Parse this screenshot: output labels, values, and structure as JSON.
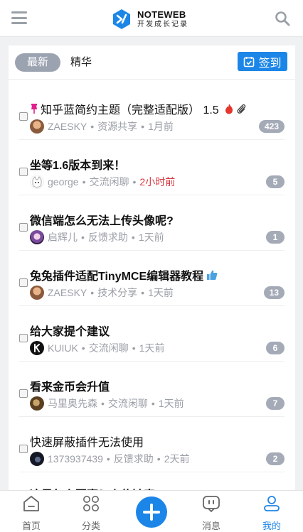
{
  "header": {
    "logo_title": "NOTEWEB",
    "logo_subtitle": "开发成长记录"
  },
  "tabs": {
    "latest": "最新",
    "featured": "精华",
    "signin": "签到"
  },
  "topics": [
    {
      "title": "知乎蓝简约主题（完整适配版） 1.5",
      "author": "ZAESKY",
      "category": "资源共享",
      "time": "1月前",
      "replies": "423",
      "pinned": true
    },
    {
      "title": "坐等1.6版本到来！",
      "author": "george",
      "category": "交流闲聊",
      "time": "2小时前",
      "replies": "5"
    },
    {
      "title": "微信端怎么无法上传头像呢?",
      "author": "启辉儿",
      "category": "反馈求助",
      "time": "1天前",
      "replies": "1"
    },
    {
      "title": "兔兔插件适配TinyMCE编辑器教程",
      "author": "ZAESKY",
      "category": "技术分享",
      "time": "1天前",
      "replies": "13"
    },
    {
      "title": "给大家提个建议",
      "author": "KUIUK",
      "category": "交流闲聊",
      "time": "1天前",
      "replies": "6"
    },
    {
      "title": "看来金币会升值",
      "author": "马里奥先森",
      "category": "交流闲聊",
      "time": "1天前",
      "replies": "7"
    },
    {
      "title": "快速屏蔽插件无法使用",
      "author": "1373937439",
      "category": "反馈求助",
      "time": "2天前",
      "replies": "2"
    },
    {
      "title": "这是怎么回事？上传缺表"
    }
  ],
  "nav": {
    "home": "首页",
    "category": "分类",
    "messages": "消息",
    "mine": "我的"
  },
  "colors": {
    "accent": "#1c86e8",
    "recent_time": "#d9363e",
    "badge": "#a5aab7"
  }
}
